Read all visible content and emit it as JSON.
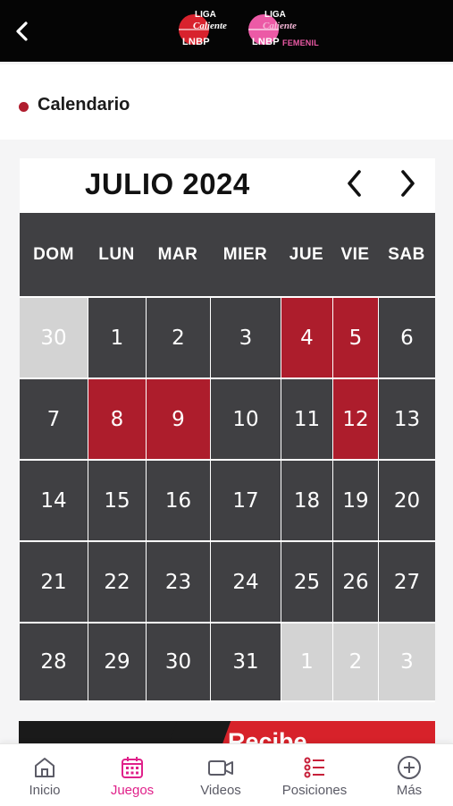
{
  "topbar": {
    "back_icon": "chevron-left-icon",
    "logo_liga": {
      "top": "LIGA",
      "script": "Caliente",
      "bottom": "LNBP"
    },
    "logo_femenil": {
      "top": "LIGA",
      "script": "Caliente",
      "bottom": "LNBP",
      "suffix": "FEMENIL"
    }
  },
  "section": {
    "title": "Calendario"
  },
  "calendar": {
    "month_title": "JULIO 2024",
    "prev_icon": "chevron-left-icon",
    "next_icon": "chevron-right-icon",
    "weekdays": [
      "DOM",
      "LUN",
      "MAR",
      "MIER",
      "JUE",
      "VIE",
      "SAB"
    ],
    "weeks": [
      [
        {
          "day": "30",
          "type": "other"
        },
        {
          "day": "1",
          "type": "normal"
        },
        {
          "day": "2",
          "type": "normal"
        },
        {
          "day": "3",
          "type": "normal"
        },
        {
          "day": "4",
          "type": "event"
        },
        {
          "day": "5",
          "type": "event"
        },
        {
          "day": "6",
          "type": "normal"
        }
      ],
      [
        {
          "day": "7",
          "type": "normal"
        },
        {
          "day": "8",
          "type": "event"
        },
        {
          "day": "9",
          "type": "event"
        },
        {
          "day": "10",
          "type": "normal"
        },
        {
          "day": "11",
          "type": "normal"
        },
        {
          "day": "12",
          "type": "event"
        },
        {
          "day": "13",
          "type": "normal"
        }
      ],
      [
        {
          "day": "14",
          "type": "normal"
        },
        {
          "day": "15",
          "type": "normal"
        },
        {
          "day": "16",
          "type": "normal"
        },
        {
          "day": "17",
          "type": "normal"
        },
        {
          "day": "18",
          "type": "normal"
        },
        {
          "day": "19",
          "type": "normal"
        },
        {
          "day": "20",
          "type": "normal"
        }
      ],
      [
        {
          "day": "21",
          "type": "normal"
        },
        {
          "day": "22",
          "type": "normal"
        },
        {
          "day": "23",
          "type": "normal"
        },
        {
          "day": "24",
          "type": "normal"
        },
        {
          "day": "25",
          "type": "normal"
        },
        {
          "day": "26",
          "type": "normal"
        },
        {
          "day": "27",
          "type": "normal"
        }
      ],
      [
        {
          "day": "28",
          "type": "normal"
        },
        {
          "day": "29",
          "type": "normal"
        },
        {
          "day": "30",
          "type": "normal"
        },
        {
          "day": "31",
          "type": "normal"
        },
        {
          "day": "1",
          "type": "other"
        },
        {
          "day": "2",
          "type": "other"
        },
        {
          "day": "3",
          "type": "other"
        }
      ]
    ]
  },
  "promo": {
    "text": "Recibe"
  },
  "bottom_nav": {
    "items": [
      {
        "label": "Inicio",
        "icon": "home-icon",
        "active": false
      },
      {
        "label": "Juegos",
        "icon": "calendar-icon",
        "active": true
      },
      {
        "label": "Videos",
        "icon": "video-camera-icon",
        "active": false
      },
      {
        "label": "Posiciones",
        "icon": "standings-list-icon",
        "active": false
      },
      {
        "label": "Más",
        "icon": "plus-circle-icon",
        "active": false
      }
    ]
  },
  "colors": {
    "topbar_bg": "#050505",
    "cell_bg": "#404043",
    "event_red": "#ad1d2c",
    "other_month_gray": "#d3d3d3",
    "active_pink": "#e0218a",
    "bullet_red": "#b01d2e"
  }
}
